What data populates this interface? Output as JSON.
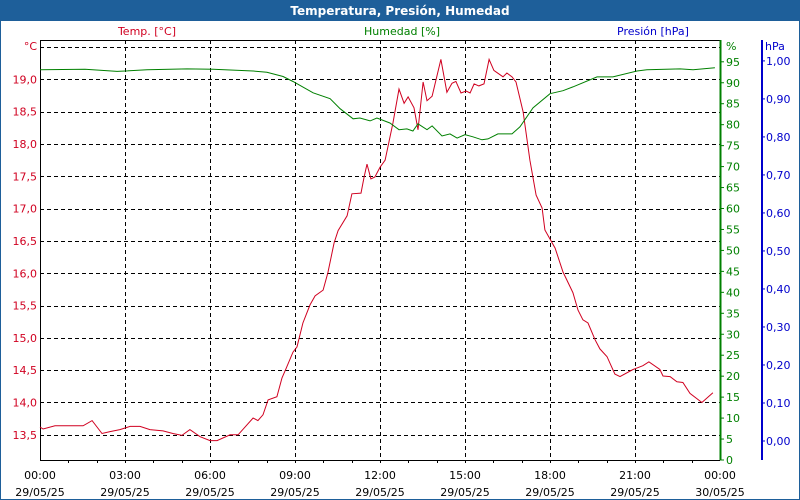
{
  "window": {
    "title": "Temperatura, Presión, Humedad"
  },
  "chart_data": {
    "type": "line",
    "title": "Temperatura, Presión, Humedad",
    "x_unit": "hours since 29/05/25 00:00",
    "xlim": [
      0,
      24
    ],
    "x_ticks": [
      {
        "h": 0,
        "time": "00:00",
        "date": "29/05/25"
      },
      {
        "h": 3,
        "time": "03:00",
        "date": "29/05/25"
      },
      {
        "h": 6,
        "time": "06:00",
        "date": "29/05/25"
      },
      {
        "h": 9,
        "time": "09:00",
        "date": "29/05/25"
      },
      {
        "h": 12,
        "time": "12:00",
        "date": "29/05/25"
      },
      {
        "h": 15,
        "time": "15:00",
        "date": "29/05/25"
      },
      {
        "h": 18,
        "time": "18:00",
        "date": "29/05/25"
      },
      {
        "h": 21,
        "time": "21:00",
        "date": "29/05/25"
      },
      {
        "h": 24,
        "time": "00:00",
        "date": "30/05/25"
      }
    ],
    "axes": {
      "temp": {
        "label": "Temp. [°C]",
        "unit": "°C",
        "ylim": [
          13.11,
          19.61
        ],
        "ticks": [
          13.5,
          14.0,
          14.5,
          15.0,
          15.5,
          16.0,
          16.5,
          17.0,
          17.5,
          18.0,
          18.5,
          19.0
        ],
        "tick_labels": [
          "13,5",
          "14,0",
          "14,5",
          "15,0",
          "15,5",
          "16,0",
          "16,5",
          "17,0",
          "17,5",
          "18,0",
          "18,5",
          "19,0"
        ],
        "grid": [
          13.5,
          14.0,
          14.5,
          15.0,
          15.5,
          16.0,
          16.5,
          17.0,
          17.5,
          18.0,
          18.5,
          19.0,
          19.5
        ],
        "color": "#d00020",
        "position": "left"
      },
      "hum": {
        "label": "Humedad [%]",
        "unit": "%",
        "ylim": [
          0,
          100.2
        ],
        "ticks": [
          0,
          5,
          10,
          15,
          20,
          25,
          30,
          35,
          40,
          45,
          50,
          55,
          60,
          65,
          70,
          75,
          80,
          85,
          90,
          95
        ],
        "tick_labels": [
          "0",
          "5",
          "10",
          "15",
          "20",
          "25",
          "30",
          "35",
          "40",
          "45",
          "50",
          "55",
          "60",
          "65",
          "70",
          "75",
          "80",
          "85",
          "90",
          "95"
        ],
        "color": "#008000",
        "position": "right"
      },
      "pres": {
        "label": "Presión [hPa]",
        "unit": "hPa",
        "ylim": [
          -0.05,
          1.055
        ],
        "ticks": [
          0,
          0.1,
          0.2,
          0.3,
          0.4,
          0.5,
          0.6,
          0.7,
          0.8,
          0.9,
          1.0
        ],
        "tick_labels": [
          "0,00",
          "0,10",
          "0,20",
          "0,30",
          "0,40",
          "0,50",
          "0,60",
          "0,70",
          "0,80",
          "0,90",
          "1,00"
        ],
        "color": "#0000cc",
        "position": "far-right"
      }
    },
    "series": [
      {
        "name": "Temp. [°C]",
        "axis": "temp",
        "color": "#d00020",
        "x": [
          0,
          0.11,
          0.53,
          1.06,
          1.52,
          1.84,
          2.19,
          2.47,
          2.82,
          3.18,
          3.53,
          3.88,
          4.34,
          4.69,
          5.01,
          5.29,
          5.65,
          6.0,
          6.25,
          6.71,
          6.99,
          7.52,
          7.69,
          7.87,
          8.05,
          8.36,
          8.54,
          8.68,
          8.93,
          9.07,
          9.28,
          9.53,
          9.71,
          9.99,
          10.16,
          10.38,
          10.52,
          10.84,
          11.01,
          11.33,
          11.44,
          11.54,
          11.68,
          11.82,
          12.0,
          12.18,
          12.46,
          12.67,
          12.85,
          12.99,
          13.2,
          13.34,
          13.52,
          13.66,
          13.84,
          14.15,
          14.36,
          14.54,
          14.68,
          14.86,
          15.04,
          15.18,
          15.32,
          15.49,
          15.67,
          15.85,
          16.02,
          16.34,
          16.48,
          16.66,
          16.8,
          17.05,
          17.29,
          17.51,
          17.72,
          17.82,
          18.18,
          18.46,
          18.81,
          18.99,
          19.16,
          19.34,
          19.59,
          19.76,
          20.01,
          20.29,
          20.47,
          20.93,
          21.28,
          21.49,
          21.88,
          21.99,
          22.24,
          22.48,
          22.69,
          22.94,
          23.36,
          23.75
        ],
        "y": [
          13.62,
          13.59,
          13.64,
          13.64,
          13.64,
          13.72,
          13.52,
          13.55,
          13.58,
          13.63,
          13.63,
          13.58,
          13.56,
          13.52,
          13.49,
          13.58,
          13.47,
          13.41,
          13.41,
          13.5,
          13.5,
          13.76,
          13.72,
          13.81,
          14.04,
          14.09,
          14.38,
          14.52,
          14.78,
          14.86,
          15.23,
          15.51,
          15.65,
          15.74,
          16.01,
          16.47,
          16.66,
          16.89,
          17.23,
          17.24,
          17.49,
          17.69,
          17.46,
          17.49,
          17.64,
          17.75,
          18.33,
          18.85,
          18.63,
          18.73,
          18.56,
          18.22,
          18.96,
          18.67,
          18.74,
          19.31,
          18.8,
          18.94,
          18.97,
          18.79,
          18.82,
          18.79,
          18.93,
          18.9,
          18.93,
          19.31,
          19.14,
          19.04,
          19.1,
          19.04,
          18.96,
          18.5,
          17.75,
          17.21,
          17.01,
          16.67,
          16.39,
          16.02,
          15.7,
          15.43,
          15.28,
          15.23,
          14.97,
          14.83,
          14.71,
          14.44,
          14.4,
          14.51,
          14.57,
          14.63,
          14.51,
          14.41,
          14.4,
          14.32,
          14.31,
          14.14,
          14.0,
          14.15
        ]
      },
      {
        "name": "Humedad [%]",
        "axis": "hum",
        "color": "#008000",
        "x": [
          0,
          1.59,
          2.72,
          3.78,
          5.19,
          6.11,
          7.52,
          8.01,
          8.58,
          8.93,
          9.64,
          10.24,
          10.59,
          11.05,
          11.29,
          11.65,
          11.89,
          12.35,
          12.67,
          12.95,
          13.16,
          13.34,
          13.66,
          13.84,
          14.19,
          14.47,
          14.72,
          15.0,
          15.28,
          15.6,
          15.81,
          16.16,
          16.66,
          16.94,
          17.4,
          18.0,
          18.46,
          18.81,
          19.66,
          20.22,
          21.07,
          21.42,
          22.59,
          23.05,
          23.82
        ],
        "y": [
          93.1,
          93.2,
          92.7,
          93.1,
          93.3,
          93.2,
          92.8,
          92.5,
          91.5,
          90.3,
          87.6,
          86.2,
          83.8,
          81.4,
          81.6,
          80.9,
          81.6,
          80.4,
          78.8,
          79.0,
          78.5,
          80.2,
          78.8,
          79.7,
          77.3,
          77.8,
          76.8,
          77.6,
          77.1,
          76.4,
          76.6,
          77.8,
          77.8,
          79.5,
          84.0,
          87.4,
          88.1,
          89.0,
          91.4,
          91.4,
          92.8,
          93.1,
          93.3,
          93.1,
          93.6
        ]
      }
    ],
    "grid": true
  }
}
